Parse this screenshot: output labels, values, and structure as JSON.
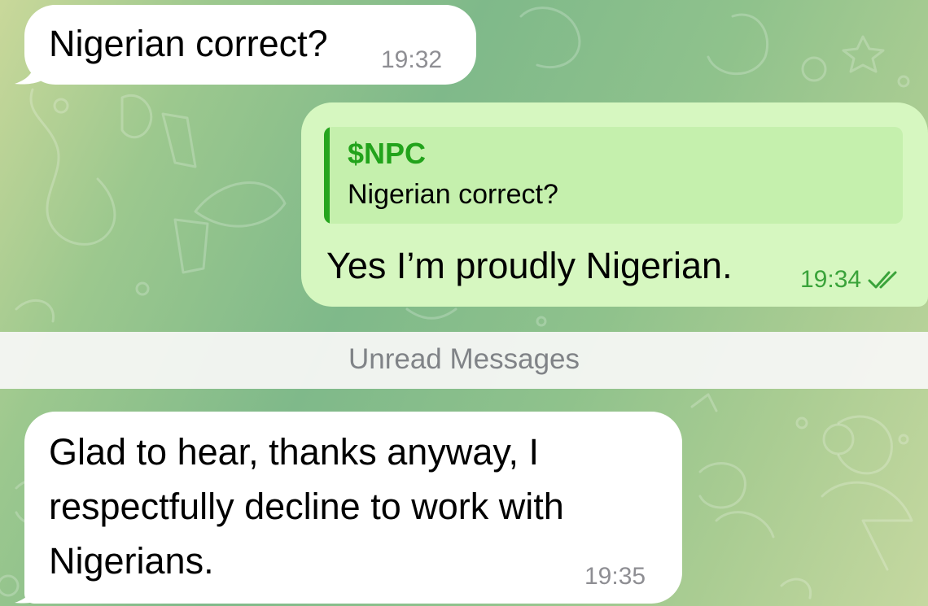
{
  "chat": {
    "messages": [
      {
        "direction": "incoming",
        "text": "Nigerian correct?",
        "time": "19:32"
      },
      {
        "direction": "outgoing",
        "reply_to": {
          "author": "$NPC",
          "text": "Nigerian correct?"
        },
        "text": "Yes I’m proudly Nigerian.",
        "time": "19:34",
        "status_icon": "double-check-icon"
      },
      {
        "direction": "incoming",
        "lines": [
          "Glad to hear, thanks anyway, I",
          "respectfully decline to work with",
          "Nigerians."
        ],
        "time": "19:35"
      }
    ],
    "unread_divider": "Unread Messages"
  },
  "colors": {
    "incoming_bubble": "#ffffff",
    "outgoing_bubble": "#d6f7c0",
    "accent_green": "#26a51e",
    "divider_text": "#808387"
  }
}
